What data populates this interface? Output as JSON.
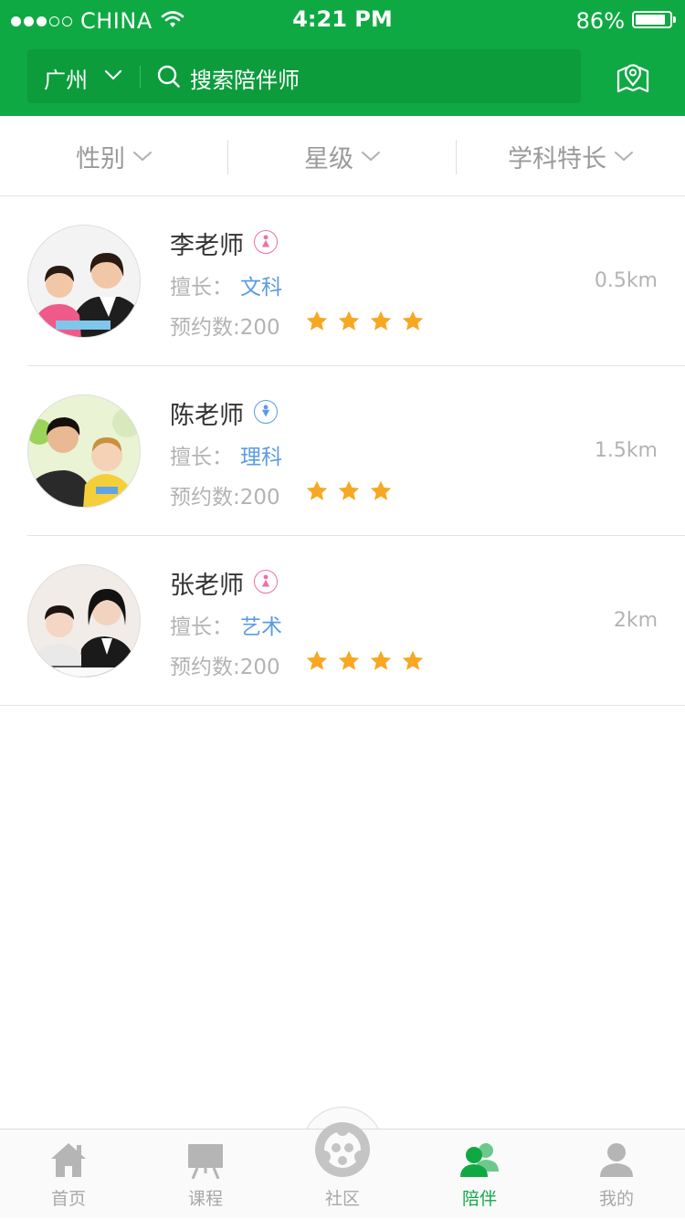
{
  "status_bar": {
    "carrier": "CHINA",
    "time": "4:21 PM",
    "battery": "86%"
  },
  "header": {
    "city": "广州",
    "search_placeholder": "搜索陪伴师"
  },
  "filters": [
    {
      "label": "性别"
    },
    {
      "label": "星级"
    },
    {
      "label": "学科特长"
    }
  ],
  "teachers": [
    {
      "name": "李老师",
      "gender": "female",
      "skill_label": "擅长：",
      "skill": "文科",
      "bookings": "预约数:200",
      "stars": 4,
      "distance": "0.5km"
    },
    {
      "name": "陈老师",
      "gender": "male",
      "skill_label": "擅长：",
      "skill": "理科",
      "bookings": "预约数:200",
      "stars": 3,
      "distance": "1.5km"
    },
    {
      "name": "张老师",
      "gender": "female",
      "skill_label": "擅长：",
      "skill": "艺术",
      "bookings": "预约数:200",
      "stars": 4,
      "distance": "2km"
    }
  ],
  "tabbar": {
    "items": [
      {
        "label": "首页",
        "icon": "home-icon"
      },
      {
        "label": "课程",
        "icon": "course-icon"
      },
      {
        "label": "社区",
        "icon": "community-icon"
      },
      {
        "label": "陪伴",
        "icon": "companion-icon",
        "active": true
      },
      {
        "label": "我的",
        "icon": "profile-icon"
      }
    ]
  },
  "colors": {
    "brand": "#0fa944",
    "link": "#5b9be6",
    "star": "#f7a823",
    "female": "#ef6fa8"
  }
}
